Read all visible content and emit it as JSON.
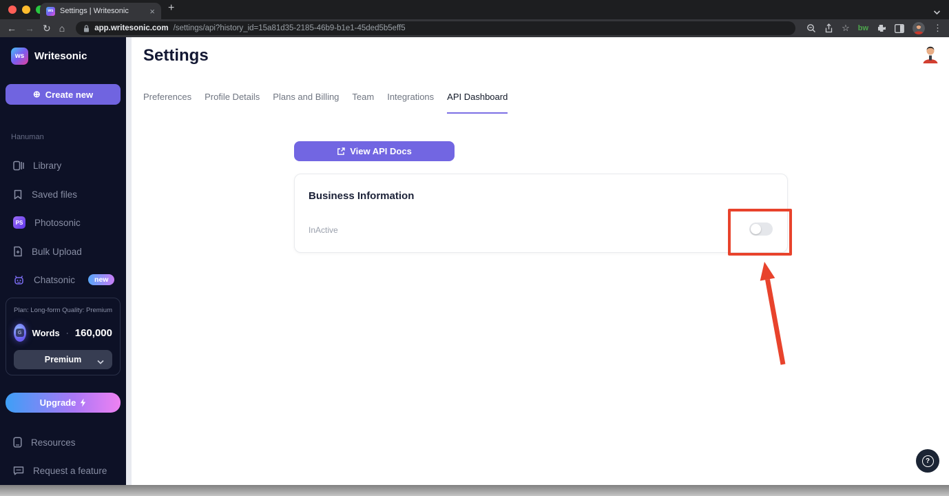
{
  "browser": {
    "tab": {
      "title": "Settings | Writesonic"
    },
    "toolbar": {
      "url_domain": "app.writesonic.com",
      "url_path": "/settings/api?history_id=15a81d35-2185-46b9-b1e1-45ded5b5eff5",
      "extension_label": "bw"
    }
  },
  "glyphs": {
    "close": "×",
    "new_tab": "+",
    "back": "←",
    "forward": "→",
    "reload": "↻",
    "home": "⌂",
    "star": "☆",
    "kebab": "⋮",
    "plus_circle": "⊕",
    "question": "?"
  },
  "sidebar": {
    "logo": {
      "badge": "ws",
      "name": "Writesonic"
    },
    "create_button": "Create new",
    "workspace": "Hanuman",
    "nav": [
      {
        "label": "Library"
      },
      {
        "label": "Saved files"
      },
      {
        "label": "Photosonic",
        "badge": "PS"
      },
      {
        "label": "Bulk Upload"
      },
      {
        "label": "Chatsonic",
        "tag": "new"
      }
    ],
    "plan_card": {
      "plan": "Plan: Long-form",
      "quality": "Quality: Premium",
      "words_label": "Words",
      "words_sep": "·",
      "words_value": "160,000",
      "tier": "Premium"
    },
    "upgrade_label": "Upgrade",
    "footer": [
      {
        "label": "Resources"
      },
      {
        "label": "Request a feature"
      }
    ]
  },
  "main": {
    "title": "Settings",
    "tabs": [
      {
        "label": "Preferences"
      },
      {
        "label": "Profile Details"
      },
      {
        "label": "Plans and Billing"
      },
      {
        "label": "Team"
      },
      {
        "label": "Integrations"
      },
      {
        "label": "API Dashboard"
      }
    ],
    "active_tab": "API Dashboard",
    "api_docs_button": "View API Docs",
    "card": {
      "title": "Business Information",
      "status_label": "InActive",
      "toggle_state": "off"
    }
  },
  "annotation": {
    "highlight_color": "#e8432c",
    "shape": "rectangle-and-arrow"
  },
  "colors": {
    "accent_purple": "#7266e2",
    "sidebar_bg": "#0d1126",
    "chrome_bg": "#35363a"
  }
}
